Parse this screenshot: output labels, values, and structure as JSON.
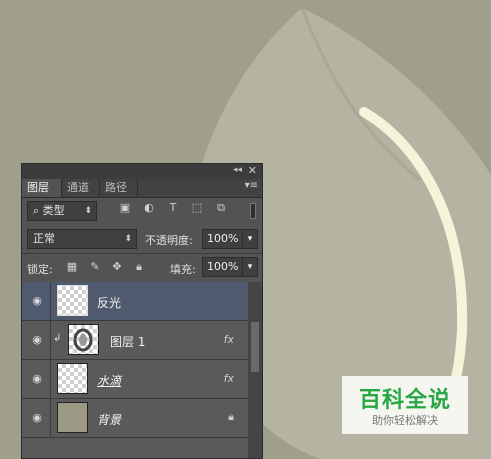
{
  "panel": {
    "tabs": [
      "图层",
      "通道",
      "路径"
    ],
    "active_tab": 0,
    "filter": {
      "label": "类型",
      "icons": [
        "image-filter-icon",
        "adjustment-filter-icon",
        "text-filter-icon",
        "shape-filter-icon",
        "smart-object-filter-icon"
      ],
      "text_icon_glyph": "T"
    },
    "blend_mode": "正常",
    "opacity_label": "不透明度:",
    "opacity_value": "100%",
    "lock_label": "锁定:",
    "fill_label": "填充:",
    "fill_value": "100%",
    "layers": [
      {
        "name": "反光",
        "selected": true,
        "fx": "",
        "thumb": "transparent"
      },
      {
        "name": "图层 1",
        "selected": false,
        "fx": "fx",
        "thumb": "drop"
      },
      {
        "name": "水滴",
        "selected": false,
        "fx": "fx",
        "thumb": "transparent"
      },
      {
        "name": "背景",
        "selected": false,
        "fx": "",
        "thumb": "solid",
        "locked": true
      }
    ]
  },
  "watermark": {
    "title": "百科全说",
    "subtitle": "助你轻松解决"
  },
  "colors": {
    "background": "#a09f8c",
    "leaf": "#b6b5a3",
    "highlight": "#f5f4da",
    "panel": "#535353",
    "selected_layer": "#4f5a6e",
    "watermark_green": "#28a745"
  }
}
